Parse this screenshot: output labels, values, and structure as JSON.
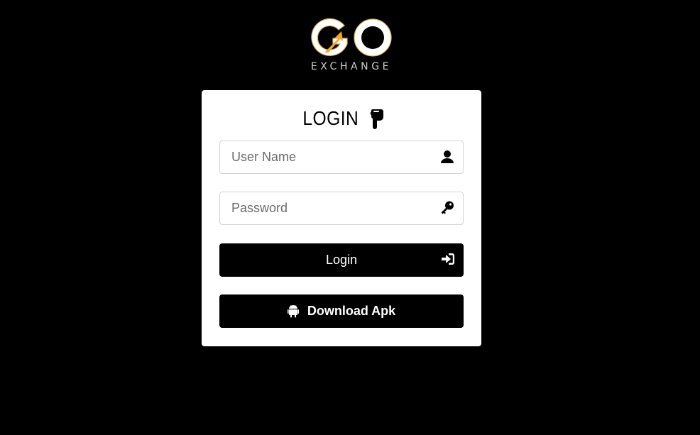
{
  "logo": {
    "letters": "GO",
    "subtitle": "EXCHANGE",
    "colors": {
      "letter": "#ffffff",
      "accent": "#f5a623",
      "outline": "#d9b25a"
    }
  },
  "login_card": {
    "title": "LOGIN",
    "title_icon": "hand-point-down-icon",
    "username": {
      "placeholder": "User Name",
      "value": "",
      "icon": "user-icon"
    },
    "password": {
      "placeholder": "Password",
      "value": "",
      "icon": "key-icon"
    },
    "login_button": {
      "label": "Login",
      "icon": "sign-in-icon"
    },
    "apk_button": {
      "label": "Download Apk",
      "icon": "android-icon"
    }
  }
}
